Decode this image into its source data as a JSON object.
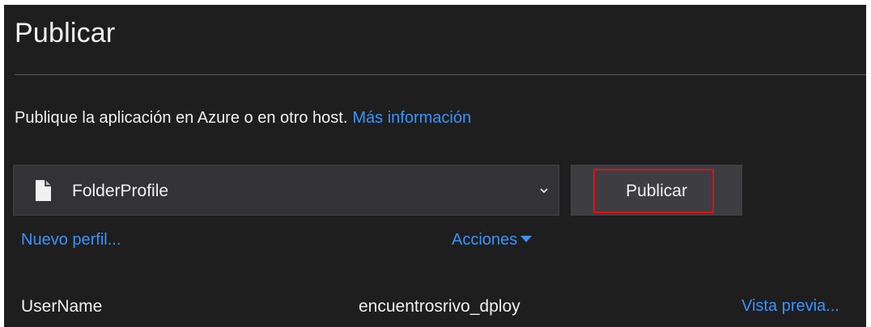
{
  "panel": {
    "title": "Publicar",
    "description": "Publique la aplicación en Azure o en otro host.",
    "more_info_link": "Más información"
  },
  "profile": {
    "selected": "FolderProfile",
    "icon": "file-icon",
    "dropdown_icon": "chevron-down-icon"
  },
  "publish_button": {
    "label": "Publicar"
  },
  "links": {
    "new_profile": "Nuevo perfil...",
    "actions": "Acciones",
    "actions_icon": "caret-down-icon"
  },
  "summary": {
    "username_label": "UserName",
    "username_value": "encuentrosrivo_dploy",
    "preview_link": "Vista previa..."
  },
  "colors": {
    "background": "#1e1e1e",
    "text": "#f1f1f1",
    "link": "#3794ff",
    "field": "#333337",
    "button": "#3e3e42",
    "highlight": "#e01010"
  }
}
